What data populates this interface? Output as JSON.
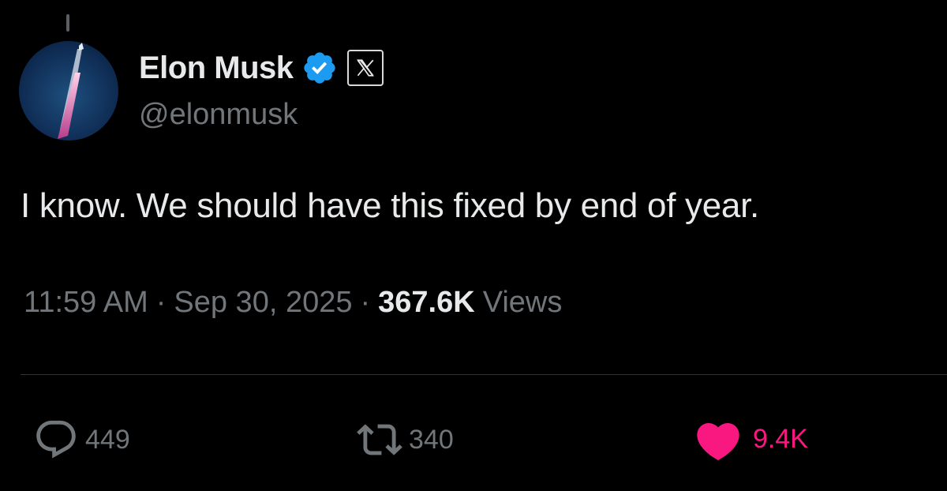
{
  "author": {
    "display_name": "Elon Musk",
    "handle": "@elonmusk",
    "verified_icon": "verified-badge-icon",
    "affiliate_badge": "x-logo-icon"
  },
  "tweet": {
    "text": "I know. We should have this fixed by end of year."
  },
  "meta": {
    "time": "11:59 AM",
    "separator": "·",
    "date": "Sep 30, 2025",
    "views_count": "367.6K",
    "views_label": "Views"
  },
  "actions": {
    "reply_count": "449",
    "retweet_count": "340",
    "like_count": "9.4K"
  },
  "colors": {
    "background": "#000000",
    "text_primary": "#e7e9ea",
    "text_secondary": "#71767b",
    "verified_blue": "#1d9bf0",
    "like_pink": "#f91880",
    "divider": "#2f3336"
  }
}
